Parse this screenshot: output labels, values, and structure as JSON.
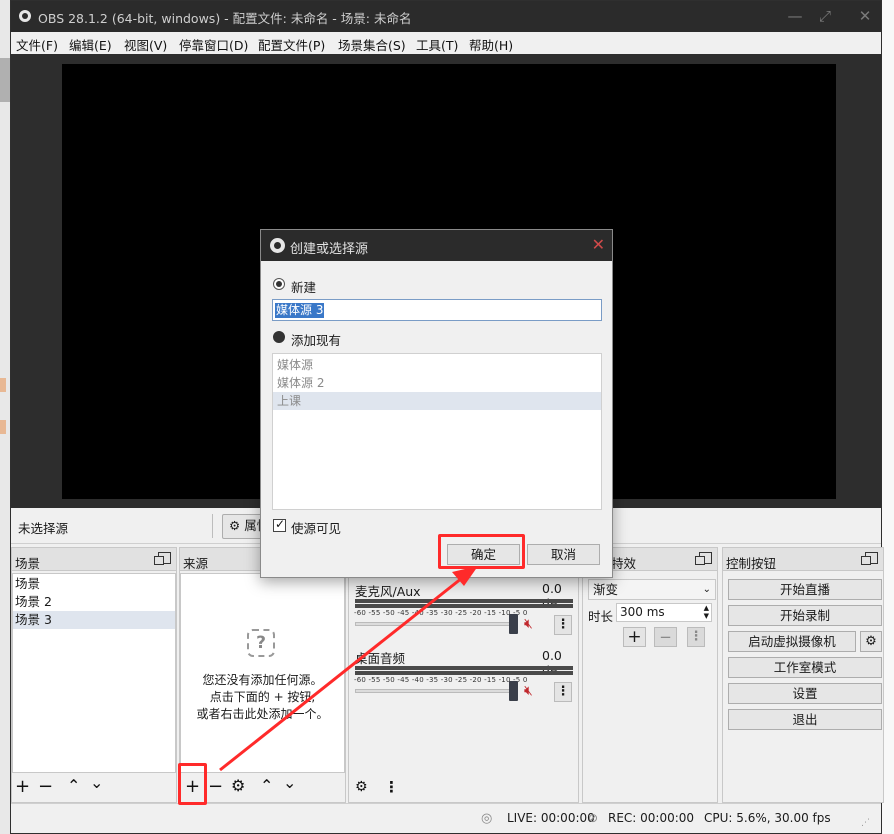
{
  "window": {
    "title": "OBS 28.1.2 (64-bit, windows) - 配置文件: 未命名 - 场景: 未命名"
  },
  "menubar": {
    "items": [
      "文件(F)",
      "编辑(E)",
      "视图(V)",
      "停靠窗口(D)",
      "配置文件(P)",
      "场景集合(S)",
      "工具(T)",
      "帮助(H)"
    ]
  },
  "source_toolbar": {
    "no_source": "未选择源",
    "properties": "属性"
  },
  "scenes": {
    "title": "场景",
    "items": [
      "场景",
      "场景 2",
      "场景 3"
    ]
  },
  "sources": {
    "title": "来源",
    "empty_icon": "?",
    "empty_line1": "您还没有添加任何源。",
    "empty_line2": "点击下面的 + 按钮,",
    "empty_line3": "或者右击此处添加一个。"
  },
  "mixer": {
    "channels": [
      {
        "name": "麦克风/Aux",
        "db": "0.0 dB"
      },
      {
        "name": "桌面音频",
        "db": "0.0 dB"
      }
    ],
    "scale": "-60 -55 -50 -45 -40 -35 -30 -25 -20 -15 -10 -5 0"
  },
  "transitions": {
    "title": "转场特效",
    "selected": "渐变",
    "duration_label": "时长",
    "duration_value": "300 ms"
  },
  "controls": {
    "title": "控制按钮",
    "buttons": [
      "开始直播",
      "开始录制",
      "启动虚拟摄像机",
      "工作室模式",
      "设置",
      "退出"
    ]
  },
  "statusbar": {
    "live": "LIVE: 00:00:00",
    "rec": "REC: 00:00:00",
    "cpu": "CPU: 5.6%, 30.00 fps"
  },
  "dialog": {
    "title": "创建或选择源",
    "new_label": "新建",
    "name_value": "媒体源 3",
    "add_existing_label": "添加现有",
    "existing": [
      "媒体源",
      "媒体源 2",
      "上课"
    ],
    "visible_label": "使源可见",
    "ok": "确定",
    "cancel": "取消"
  },
  "colors": {
    "annotation": "#ff2a2a",
    "titlebar": "#2b2b2b",
    "preview": "#000000"
  }
}
